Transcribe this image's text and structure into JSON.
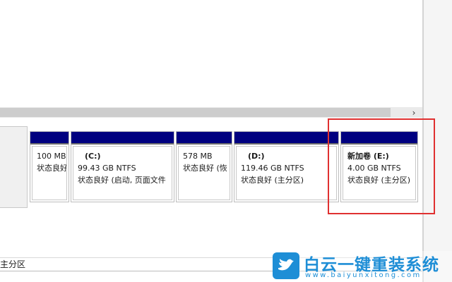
{
  "scrollbar": {
    "right_arrow": "›"
  },
  "partitions": [
    {
      "name": "",
      "size": "100 MB",
      "status": "状态良好"
    },
    {
      "name": "(C:)",
      "size": "99.43 GB NTFS",
      "status": "状态良好 (启动, 页面文件"
    },
    {
      "name": "",
      "size": "578 MB",
      "status": "状态良好 (恢"
    },
    {
      "name": "(D:)",
      "size": "119.46 GB NTFS",
      "status": "状态良好 (主分区)"
    },
    {
      "name": "新加卷  (E:)",
      "size": "4.00 GB NTFS",
      "status": "状态良好 (主分区)"
    }
  ],
  "legend": {
    "primary_partition": "主分区"
  },
  "colors": {
    "partition_bar": "#000080",
    "highlight": "#e03030",
    "watermark": "#1e8ed6"
  },
  "watermark": {
    "title": "白云一键重装系统",
    "url": "www.baiyunxitong.com",
    "icon": "bird-icon"
  }
}
